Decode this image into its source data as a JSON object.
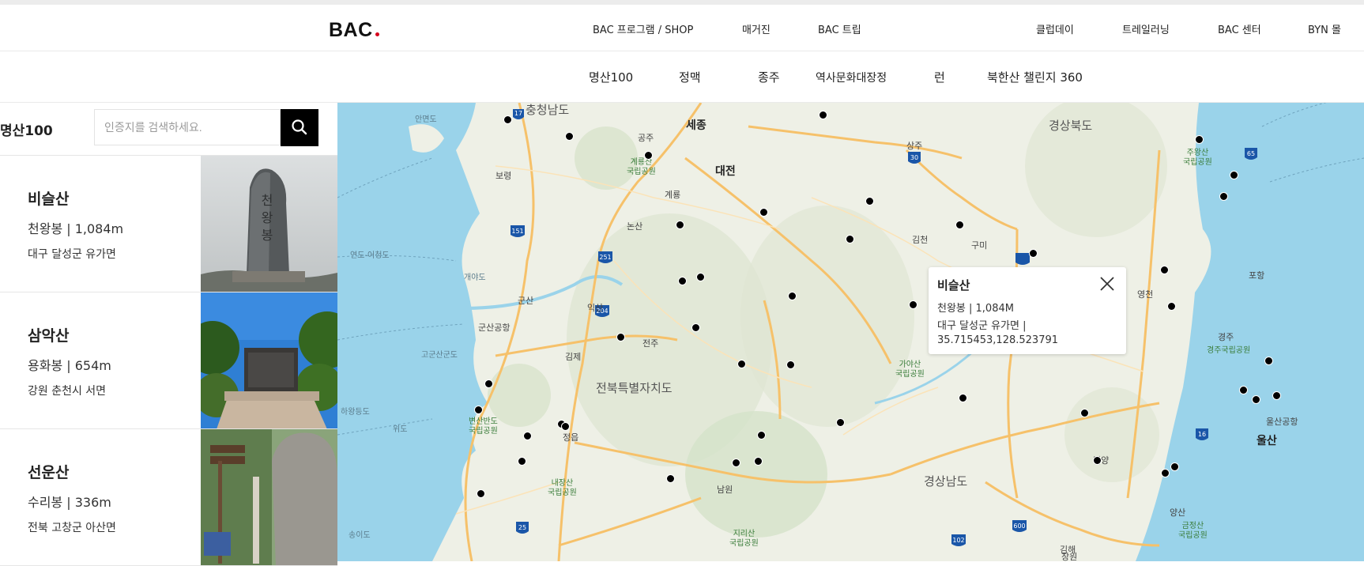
{
  "header": {
    "logo": "BAC",
    "nav_top": [
      "BAC 프로그램 / SHOP",
      "매거진",
      "BAC 트립",
      "클럽데이",
      "트레일러닝",
      "BAC 센터",
      "BYN 몰"
    ],
    "nav_sub": [
      "명산100",
      "정맥",
      "종주",
      "역사문화대장정",
      "런",
      "북한산 챌린지 360"
    ]
  },
  "sidebar": {
    "title": "명산100",
    "search_placeholder": "인증지를 검색하세요.",
    "search_icon": "search-icon",
    "mountains": [
      {
        "name": "비슬산",
        "peak": "천왕봉 | 1,084m",
        "location": "대구 달성군 유가면"
      },
      {
        "name": "삼악산",
        "peak": "용화봉 | 654m",
        "location": "강원 춘천시 서면"
      },
      {
        "name": "선운산",
        "peak": "수리봉 | 336m",
        "location": "전북 고창군 아산면"
      }
    ]
  },
  "popup": {
    "name": "비슬산",
    "peak": "천왕봉 | 1,084M",
    "location": "대구 달성군 유가면 |",
    "coords": "35.715453,128.523791",
    "close_icon": "close-icon"
  },
  "map": {
    "labels": {
      "chungnam": "충청남도",
      "sejong": "세종",
      "daejeon": "대전",
      "gongju": "공주",
      "boryeong": "보령",
      "gyeryong": "계룡",
      "nonsan": "논산",
      "sangju": "상주",
      "gimcheon": "김천",
      "gumi": "구미",
      "gyeongbuk": "경상북도",
      "gyeongnam": "경상남도",
      "jeonbuk": "전북특별자치도",
      "gunsan": "군산",
      "iksan": "익산",
      "jeonju": "전주",
      "gimje": "김제",
      "jeongeup": "정읍",
      "namwon": "남원",
      "miryang": "밀양",
      "yeongcheon": "영천",
      "pohang": "포항",
      "gyeongju": "경주",
      "ulsan": "울산",
      "ulsan_airport": "울산공항",
      "yangsan": "양산",
      "gimhae": "김해",
      "changwon": "창원",
      "gunsan_airport": "군산공항",
      "anmyeondo": "안면도",
      "yeondo": "연도-어청도",
      "gaeyado": "개야도",
      "gogunsan": "고군산군도",
      "hawangdeungdo": "하왕등도",
      "wido": "위도",
      "songido": "송이도",
      "park_gyeryong": "계룡산\n국립공원",
      "park_gaya": "가야산\n국립공원",
      "park_byeonsan": "변산반도\n국립공원",
      "park_naejang": "내장산\n국립공원",
      "park_jiri": "지리산\n국립공원",
      "park_juwang": "주왕산\n국립공원",
      "park_gyeongju": "경주국립공원",
      "park_geumjeong": "금정산\n국립공원"
    },
    "marker_count": 46
  }
}
